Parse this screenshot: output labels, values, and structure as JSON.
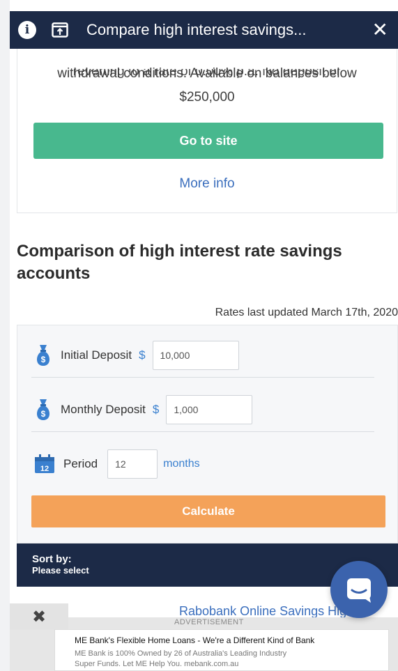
{
  "topbar": {
    "title": "Compare high interest savings...",
    "info_icon": "info-icon",
    "share_icon": "share-icon",
    "close_icon": "close-icon",
    "close_glyph": "✕",
    "info_glyph": "i"
  },
  "card": {
    "clipped_text": "reverting to a rate of 0.00% p.a. No deposit or",
    "description": "withdrawal conditions. Available on balances below $250,000",
    "go_to_site": "Go to site",
    "more_info": "More info"
  },
  "comparison": {
    "heading": "Comparison of high interest rate savings accounts",
    "rates_updated": "Rates last updated March 17th, 2020"
  },
  "calculator": {
    "initial_deposit_label": "Initial Deposit",
    "initial_currency": "$",
    "initial_value": "10,000",
    "monthly_deposit_label": "Monthly Deposit",
    "monthly_currency": "$",
    "monthly_value": "1,000",
    "period_label": "Period",
    "period_value": "12",
    "period_unit": "months",
    "calendar_number": "12",
    "calculate": "Calculate"
  },
  "sort": {
    "title": "Sort by:",
    "value": "Please select"
  },
  "result": {
    "bank_link": "Rabobank Online Savings High"
  },
  "ad": {
    "label": "ADVERTISEMENT",
    "close_glyph": "✖",
    "title": "ME Bank's Flexible Home Loans - We're a Different Kind of Bank",
    "body_line1": "ME Bank is 100% Owned by 26 of Australia's Leading Industry",
    "body_line2": "Super Funds. Let ME Help You. mebank.com.au"
  },
  "colors": {
    "navy": "#1c2a47",
    "green": "#48b88e",
    "orange": "#f4a259",
    "link": "#3a6ebd",
    "chat": "#3b63ad"
  }
}
